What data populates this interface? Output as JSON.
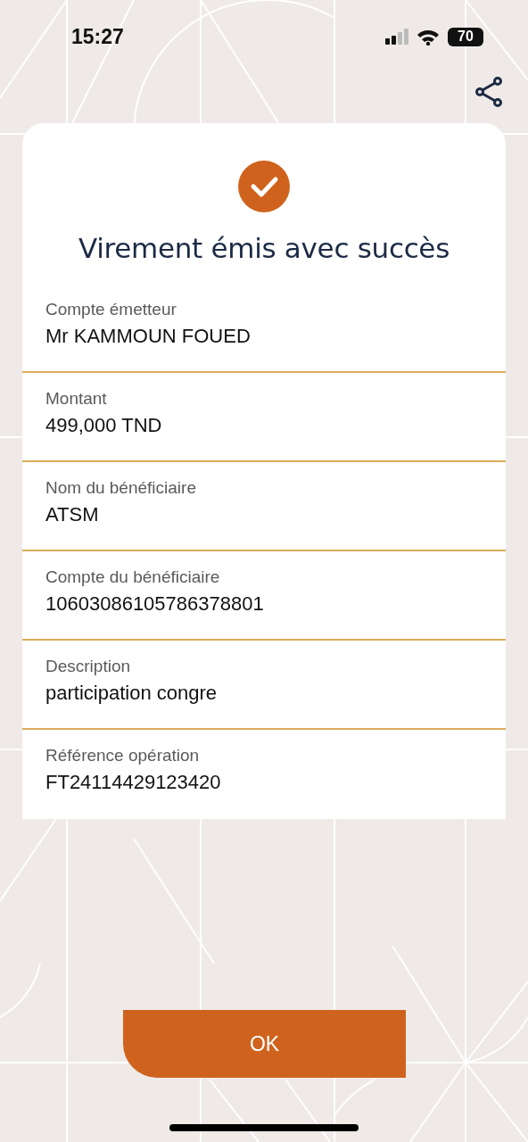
{
  "status_bar": {
    "time": "15:27",
    "battery": "70"
  },
  "title": "Virement émis avec succès",
  "details": [
    {
      "label": "Compte émetteur",
      "value": "Mr KAMMOUN FOUED"
    },
    {
      "label": "Montant",
      "value": "499,000 TND"
    },
    {
      "label": "Nom du bénéficiaire",
      "value": "ATSM"
    },
    {
      "label": "Compte du bénéficiaire",
      "value": "10603086105786378801"
    },
    {
      "label": "Description",
      "value": "participation congre"
    },
    {
      "label": "Référence opération",
      "value": "FT24114429123420"
    }
  ],
  "button": {
    "label": "OK"
  }
}
